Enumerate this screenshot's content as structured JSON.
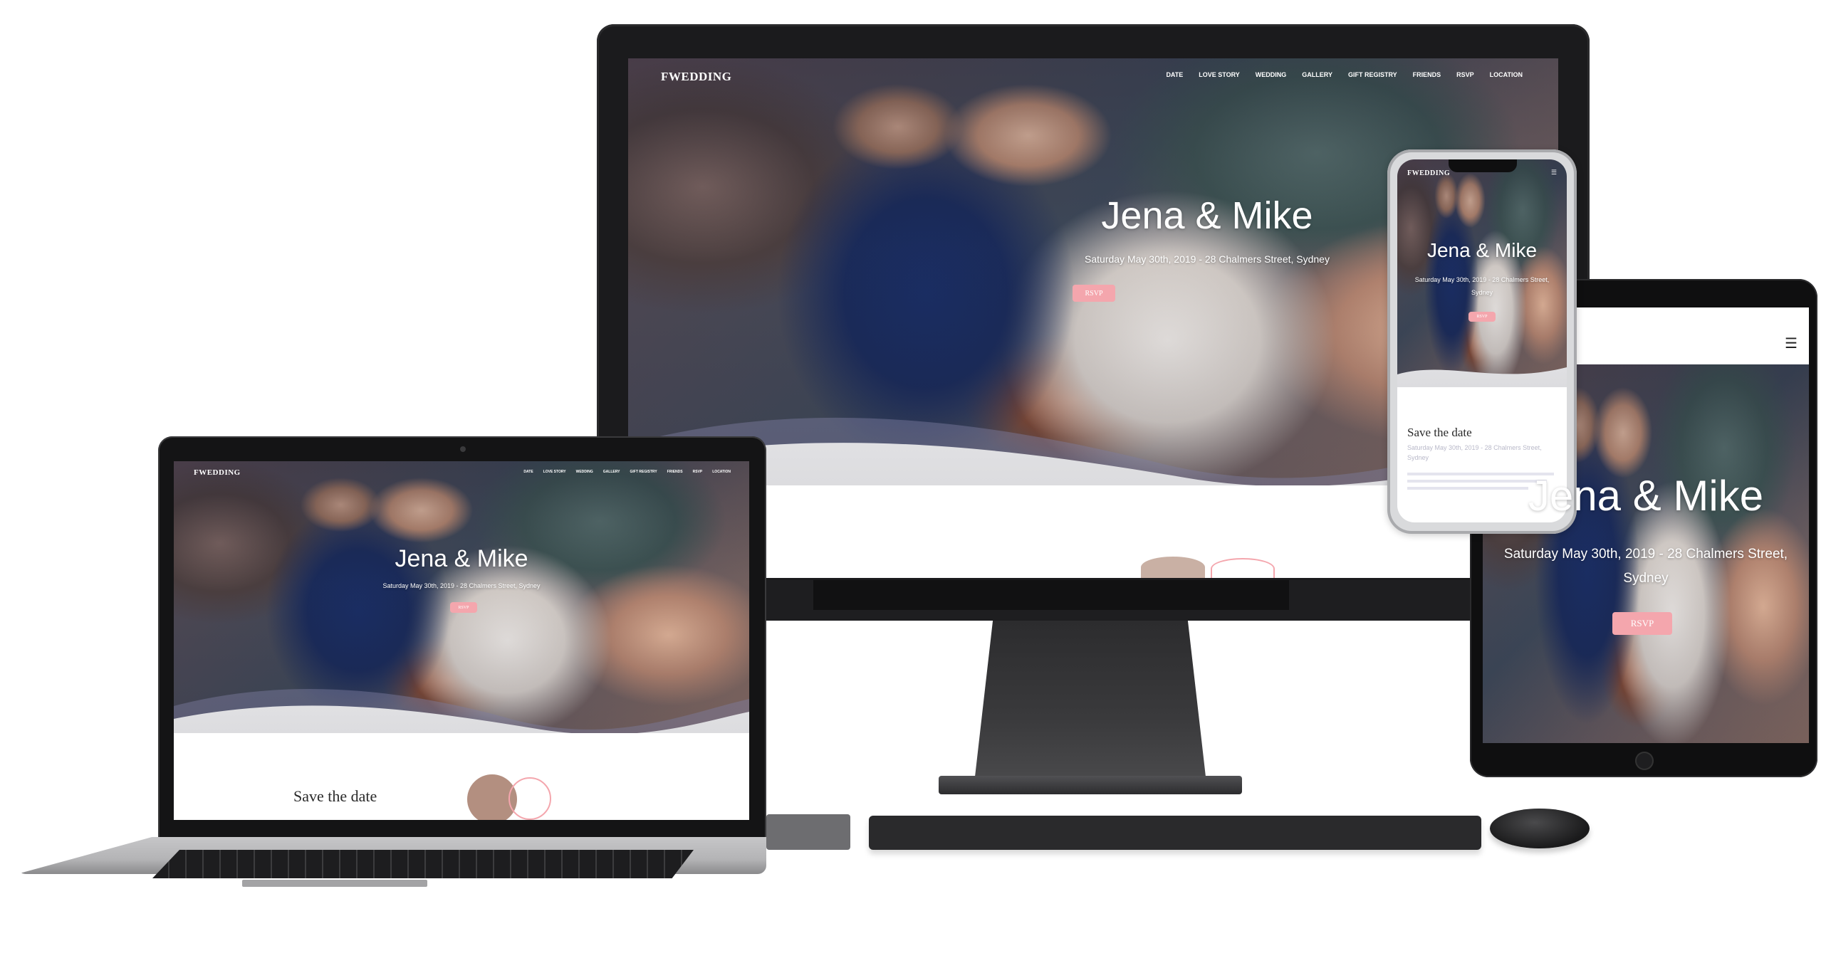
{
  "site": {
    "logo": "FWEDDING",
    "couple": "Jena & Mike",
    "details": "Saturday May 30th, 2019 - 28 Chalmers Street, Sydney",
    "details_line1": "Saturday May 30th, 2019 - 28 Chalmers Street,",
    "details_line2": "Sydney",
    "rsvp_label": "RSVP",
    "save_the_date": "Save the date",
    "menu_icon": "hamburger-icon",
    "nav": [
      {
        "label": "DATE"
      },
      {
        "label": "LOVE STORY"
      },
      {
        "label": "WEDDING"
      },
      {
        "label": "GALLERY"
      },
      {
        "label": "GIFT REGISTRY"
      },
      {
        "label": "FRIENDS"
      },
      {
        "label": "RSVP"
      },
      {
        "label": "LOCATION"
      }
    ]
  },
  "colors": {
    "accent": "#f4a6ad",
    "device_dark": "#1b1b1d",
    "wave_tint": "#8d8fb3"
  }
}
